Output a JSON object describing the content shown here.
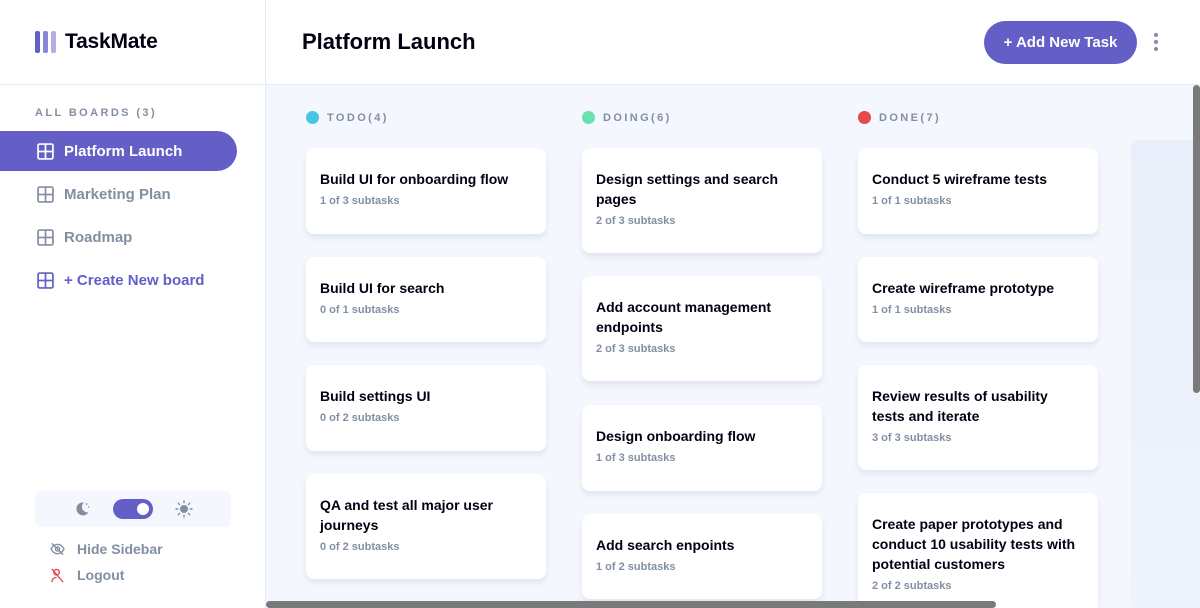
{
  "app": {
    "name": "TaskMate"
  },
  "header": {
    "title": "Platform Launch",
    "add_task_label": "+ Add New Task"
  },
  "sidebar": {
    "boards_heading": "ALL BOARDS (3)",
    "boards": [
      {
        "label": "Platform Launch",
        "active": true
      },
      {
        "label": "Marketing Plan",
        "active": false
      },
      {
        "label": "Roadmap",
        "active": false
      }
    ],
    "create_label": "+ Create New board",
    "hide_label": "Hide Sidebar",
    "logout_label": "Logout",
    "theme": "dark"
  },
  "columns": [
    {
      "name": "TODO(4)",
      "color": "#49c4e5",
      "tasks": [
        {
          "title": "Build UI for onboarding flow",
          "subtasks": "1 of 3 subtasks"
        },
        {
          "title": "Build UI for search",
          "subtasks": "0 of 1 subtasks"
        },
        {
          "title": "Build settings UI",
          "subtasks": "0 of 2 subtasks"
        },
        {
          "title": "QA and test all major user journeys",
          "subtasks": "0 of 2 subtasks"
        }
      ]
    },
    {
      "name": "DOING(6)",
      "color": "#67e2ae",
      "tasks": [
        {
          "title": "Design settings and search pages",
          "subtasks": "2 of 3 subtasks"
        },
        {
          "title": "Add account management endpoints",
          "subtasks": "2 of 3 subtasks"
        },
        {
          "title": "Design onboarding flow",
          "subtasks": "1 of 3 subtasks"
        },
        {
          "title": "Add search enpoints",
          "subtasks": "1 of 2 subtasks"
        }
      ]
    },
    {
      "name": "DONE(7)",
      "color": "#e5484d",
      "tasks": [
        {
          "title": "Conduct 5 wireframe tests",
          "subtasks": "1 of 1 subtasks"
        },
        {
          "title": "Create wireframe prototype",
          "subtasks": "1 of 1 subtasks"
        },
        {
          "title": "Review results of usability tests and iterate",
          "subtasks": "3 of 3 subtasks"
        },
        {
          "title": "Create paper prototypes and conduct 10 usability tests with potential customers",
          "subtasks": "2 of 2 subtasks"
        }
      ]
    }
  ],
  "colors": {
    "accent": "#635fc7",
    "muted": "#828fa3"
  }
}
